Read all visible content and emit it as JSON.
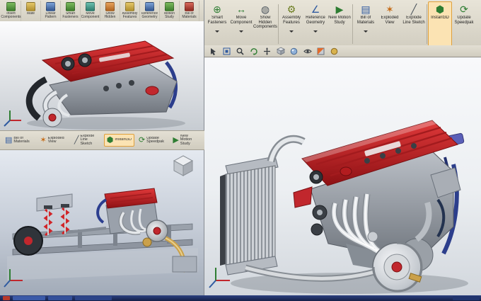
{
  "colors": {
    "valve_cover_red": "#c1272d",
    "toolbar_beige": "#d8d4c8",
    "taskbar_navy": "#16245c",
    "viewport_gray": "#eceff2",
    "highlight_orange": "#dfa03c",
    "hose_blue": "#2c3e8c",
    "manifold_chrome": "#e4e7ea",
    "turbo_gold": "#caa04a"
  },
  "icons": {
    "smart_fasteners": "⊕",
    "move_component": "↔",
    "show_hidden": "◍",
    "assembly_features": "⚙",
    "reference_geometry": "∠",
    "motion_study": "▶",
    "bill_of_materials": "▤",
    "exploded_view": "✶",
    "explode_line_sketch": "╱",
    "instant3d": "⬢",
    "update_speedpak": "⟳"
  },
  "tl_toolbar": {
    "items": [
      {
        "label": "Insert Components"
      },
      {
        "label": "Mate"
      },
      {
        "label": "Linear Pattern"
      },
      {
        "label": "Smart Fasteners"
      },
      {
        "label": "Move Component"
      },
      {
        "label": "Show Hidden"
      },
      {
        "label": "Assembly Features"
      },
      {
        "label": "Reference Geometry"
      },
      {
        "label": "Motion Study"
      },
      {
        "label": "Bill of Materials"
      }
    ]
  },
  "mid_toolbar": {
    "items": [
      {
        "label": "Bill of Materials"
      },
      {
        "label": "Exploded View"
      },
      {
        "label": "Explode Line Sketch"
      },
      {
        "label": "Instant3D"
      },
      {
        "label": "Update Speedpak"
      },
      {
        "label": "New Motion Study"
      }
    ]
  },
  "cm": {
    "buttons": [
      {
        "label": "Smart Fasteners"
      },
      {
        "label": "Move Component"
      },
      {
        "label": "Show Hidden Components"
      },
      {
        "label": "Assembly Features"
      },
      {
        "label": "Reference Geometry"
      },
      {
        "label": "New Motion Study"
      },
      {
        "label": "Bill of Materials"
      },
      {
        "label": "Exploded View"
      },
      {
        "label": "Explode Line Sketch"
      },
      {
        "label": "Instant3D"
      },
      {
        "label": "Update Speedpak"
      }
    ]
  }
}
